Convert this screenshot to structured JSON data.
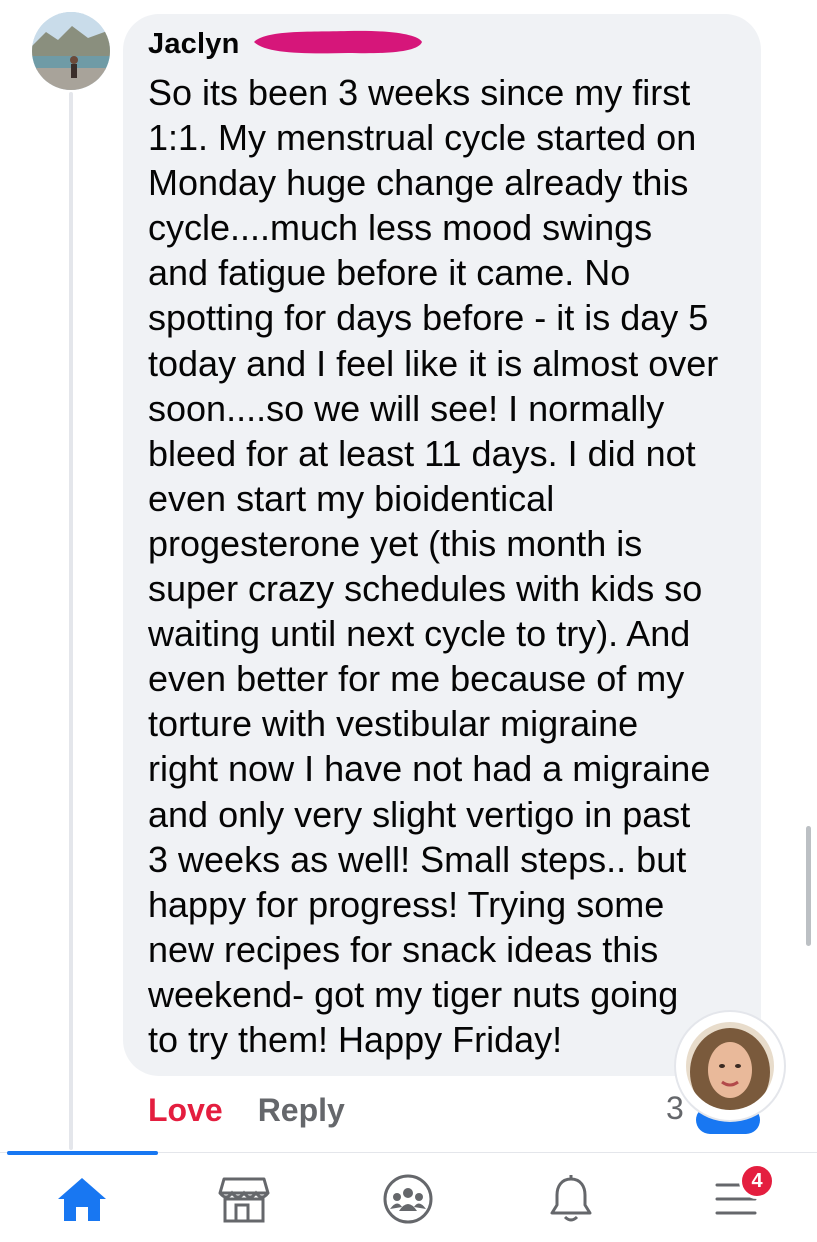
{
  "comment": {
    "author": "Jaclyn",
    "text": "So its been 3 weeks since my first\n1:1. My menstrual cycle started on\nMonday huge change already this\ncycle....much less mood swings\nand fatigue before it came. No\nspotting for days before - it is day 5\ntoday and I feel like it is almost over\nsoon....so we will see! I normally\nbleed for at least 11 days. I did not\neven start my bioidentical\nprogesterone yet (this month is\nsuper crazy schedules with kids so\nwaiting until next cycle to try). And\neven better for me because of my\ntorture with vestibular migraine\nright now I have not had a migraine\nand only very slight vertigo in past\n3 weeks as well! Small steps.. but\nhappy for progress! Trying some\nnew recipes for snack ideas this\nweekend- got my tiger nuts going\nto try them! Happy Friday!",
    "actions": {
      "love_label": "Love",
      "reply_label": "Reply"
    },
    "reaction_count": "3"
  },
  "tabbar": {
    "items": [
      {
        "name": "home",
        "icon": "home-icon",
        "active": true
      },
      {
        "name": "marketplace",
        "icon": "marketplace-icon",
        "active": false
      },
      {
        "name": "groups",
        "icon": "groups-icon",
        "active": false
      },
      {
        "name": "notifications",
        "icon": "bell-icon",
        "active": false
      },
      {
        "name": "menu",
        "icon": "menu-icon",
        "active": false
      }
    ],
    "menu_badge": "4"
  },
  "colors": {
    "accent": "#1877f2",
    "love": "#e41e3f",
    "bubble": "#f0f2f5",
    "muted": "#65676b",
    "redaction": "#d6167a"
  }
}
